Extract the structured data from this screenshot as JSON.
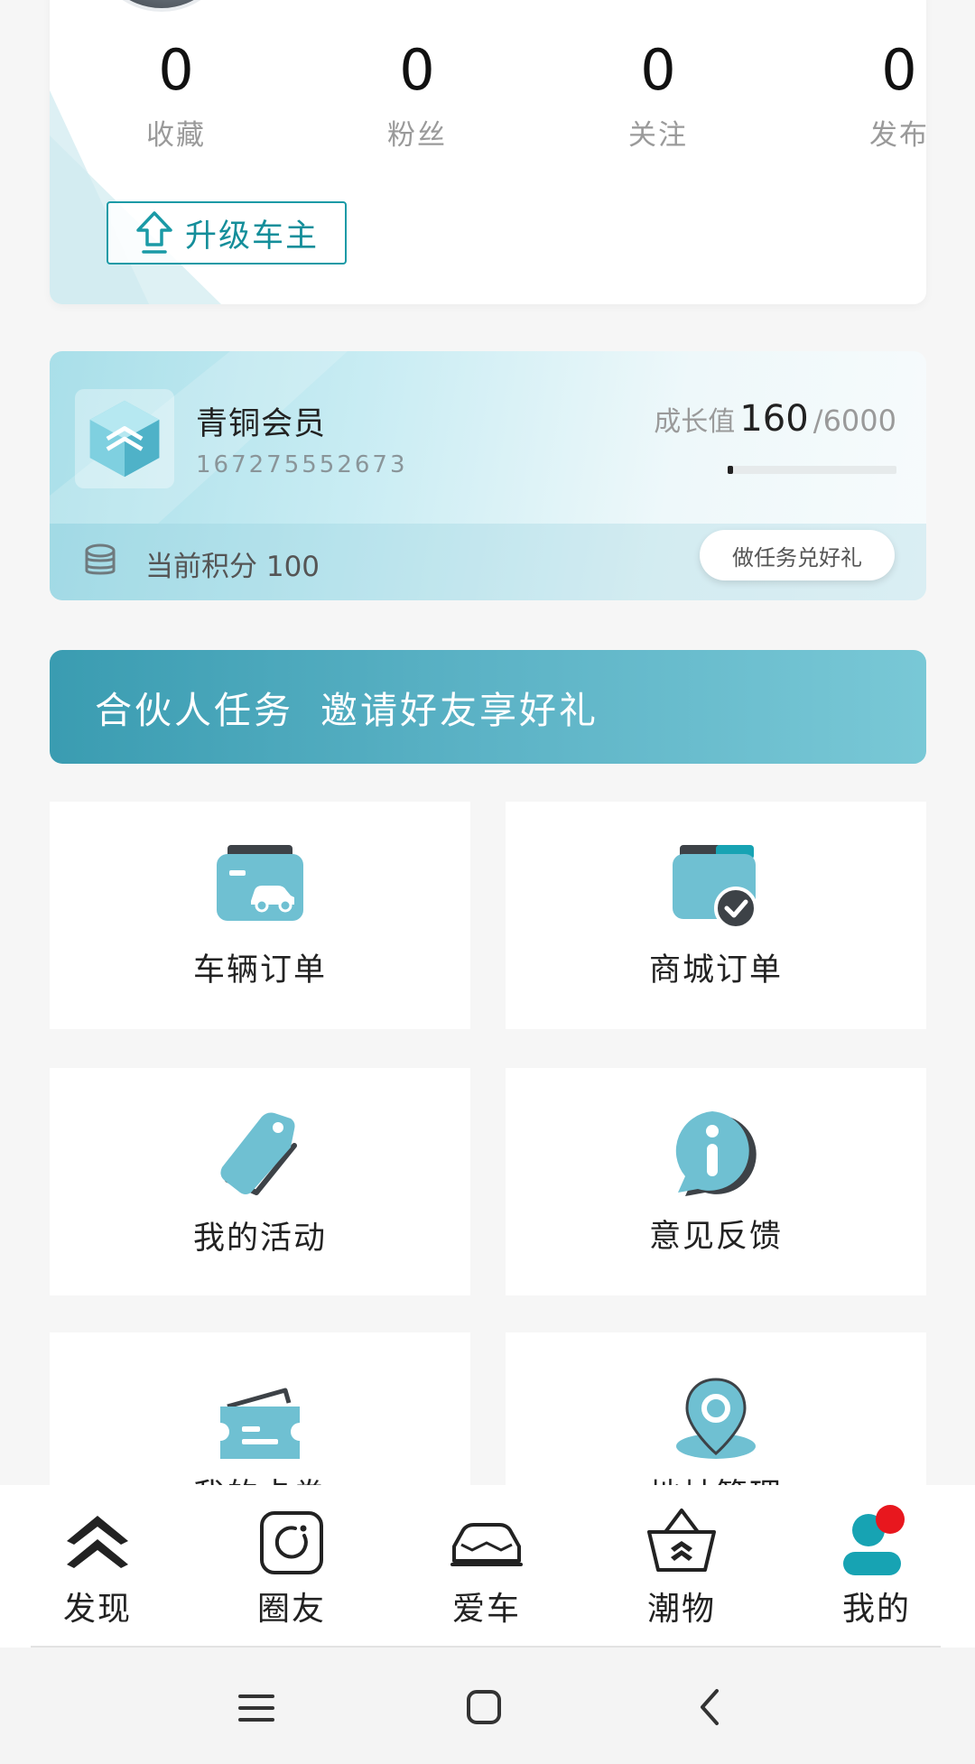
{
  "profile": {
    "stats": [
      {
        "value": "0",
        "label": "收藏"
      },
      {
        "value": "0",
        "label": "粉丝"
      },
      {
        "value": "0",
        "label": "关注"
      },
      {
        "value": "0",
        "label": "发布"
      }
    ],
    "upgrade_label": "升级车主"
  },
  "member": {
    "level": "青铜会员",
    "phone": "167275552673",
    "growth_label": "成长值",
    "growth_value": "160",
    "growth_max": "/6000",
    "growth_fraction": 0.027,
    "points_text": "当前积分 100",
    "task_button": "做任务兑好礼"
  },
  "partner_banner": {
    "part1": "合伙人任务",
    "part2": "邀请好友享好礼"
  },
  "grid": [
    {
      "label": "车辆订单",
      "icon": "car-order-icon"
    },
    {
      "label": "商城订单",
      "icon": "mall-order-icon"
    },
    {
      "label": "我的活动",
      "icon": "tag-icon"
    },
    {
      "label": "意见反馈",
      "icon": "info-icon"
    },
    {
      "label": "我的卡券",
      "icon": "coupon-icon"
    },
    {
      "label": "地址管理",
      "icon": "location-icon"
    }
  ],
  "tabbar": [
    {
      "label": "发现",
      "icon": "discover-chevron-icon"
    },
    {
      "label": "圈友",
      "icon": "circle-friends-icon"
    },
    {
      "label": "爱车",
      "icon": "car-icon"
    },
    {
      "label": "潮物",
      "icon": "basket-icon"
    },
    {
      "label": "我的",
      "icon": "profile-icon"
    }
  ],
  "colors": {
    "accent": "#1a9aa6",
    "tile_icon": "#6fc0d2",
    "notification_dot": "#e8171e"
  }
}
